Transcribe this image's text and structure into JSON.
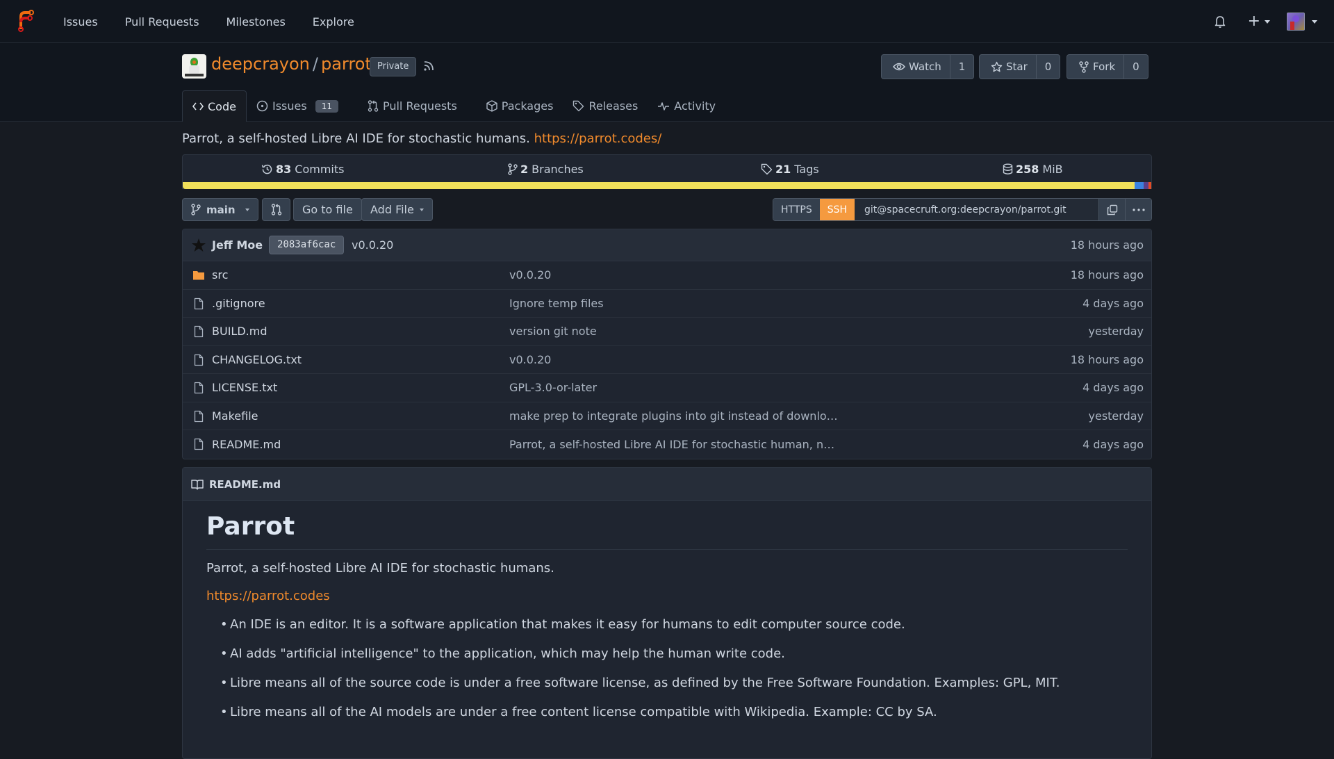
{
  "topnav": {
    "items": [
      "Issues",
      "Pull Requests",
      "Milestones",
      "Explore"
    ],
    "icons": {
      "notifications": "bell-icon",
      "create": "plus-icon",
      "user": "avatar"
    }
  },
  "repo": {
    "owner": "deepcrayon",
    "separator": "/",
    "name": "parrot",
    "visibility": "Private",
    "watch": {
      "label": "Watch",
      "count": "1"
    },
    "star": {
      "label": "Star",
      "count": "0"
    },
    "fork": {
      "label": "Fork",
      "count": "0"
    },
    "tabs": [
      {
        "label": "Code",
        "icon": "code-icon",
        "active": true
      },
      {
        "label": "Issues",
        "icon": "issue-icon",
        "badge": "11"
      },
      {
        "label": "Pull Requests",
        "icon": "pull-request-icon"
      },
      {
        "label": "Packages",
        "icon": "package-icon"
      },
      {
        "label": "Releases",
        "icon": "tag-icon"
      },
      {
        "label": "Activity",
        "icon": "pulse-icon"
      }
    ],
    "description": "Parrot, a self-hosted Libre AI IDE for stochastic humans.",
    "website": "https://parrot.codes/"
  },
  "stats": {
    "commits": {
      "count": "83",
      "label": "Commits"
    },
    "branches": {
      "count": "2",
      "label": "Branches"
    },
    "tags": {
      "count": "21",
      "label": "Tags"
    },
    "size": {
      "count": "258",
      "label": "MiB"
    }
  },
  "languages": [
    {
      "color": "#f1e05a",
      "percent": 98.3
    },
    {
      "color": "#3b82e0",
      "percent": 0.9
    },
    {
      "color": "#5b3f8a",
      "percent": 0.5
    },
    {
      "color": "#e34c26",
      "percent": 0.3
    }
  ],
  "toolbar": {
    "branch": "main",
    "go_to_file": "Go to file",
    "add_file": "Add File",
    "clone": {
      "https": "HTTPS",
      "ssh": "SSH",
      "active": "SSH",
      "url": "git@spacecruft.org:deepcrayon/parrot.git"
    }
  },
  "latest_commit": {
    "author": "Jeff Moe",
    "sha": "2083af6cac",
    "message": "v0.0.20",
    "time": "18 hours ago"
  },
  "files": [
    {
      "name": "src",
      "type": "folder",
      "message": "v0.0.20",
      "time": "18 hours ago"
    },
    {
      "name": ".gitignore",
      "type": "file",
      "message": "Ignore temp files",
      "time": "4 days ago"
    },
    {
      "name": "BUILD.md",
      "type": "file",
      "message": "version git note",
      "time": "yesterday"
    },
    {
      "name": "CHANGELOG.txt",
      "type": "file",
      "message": "v0.0.20",
      "time": "18 hours ago"
    },
    {
      "name": "LICENSE.txt",
      "type": "file",
      "message": "GPL-3.0-or-later",
      "time": "4 days ago"
    },
    {
      "name": "Makefile",
      "type": "file",
      "message": "make prep to integrate plugins into git instead of downlo…",
      "time": "yesterday"
    },
    {
      "name": "README.md",
      "type": "file",
      "message": "Parrot, a self-hosted Libre AI IDE for stochastic human, n…",
      "time": "4 days ago"
    }
  ],
  "readme": {
    "filename": "README.md",
    "title": "Parrot",
    "intro": "Parrot, a self-hosted Libre AI IDE for stochastic humans.",
    "link": "https://parrot.codes",
    "bullets": [
      "An IDE is an editor. It is a software application that makes it easy for humans to edit computer source code.",
      "AI adds \"artificial intelligence\" to the application, which may help the human write code.",
      "Libre means all of the source code is under a free software license, as defined by the Free Software Foundation. Examples: GPL, MIT.",
      "Libre means all of the AI models are under a free content license compatible with Wikipedia. Example: CC by SA."
    ]
  }
}
